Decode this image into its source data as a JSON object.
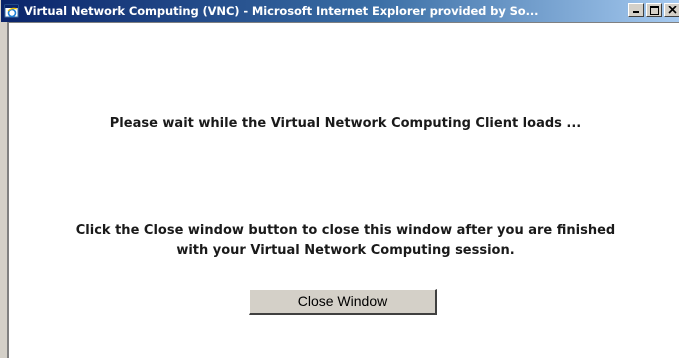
{
  "window": {
    "title": "Virtual Network Computing (VNC) - Microsoft Internet Explorer provided by So..."
  },
  "content": {
    "wait_message": "Please wait while the Virtual Network Computing Client loads ...",
    "close_instruction_line1": "Click the Close window button to close this window after you are finished",
    "close_instruction_line2": "with your Virtual Network Computing session.",
    "close_button_label": "Close Window"
  },
  "icons": {
    "app": "internet-explorer-icon",
    "minimize": "minimize-icon",
    "maximize": "maximize-icon",
    "close": "close-icon"
  },
  "colors": {
    "titlebar_start": "#0a246a",
    "titlebar_end": "#a6caf0",
    "button_face": "#d4d0c8"
  }
}
